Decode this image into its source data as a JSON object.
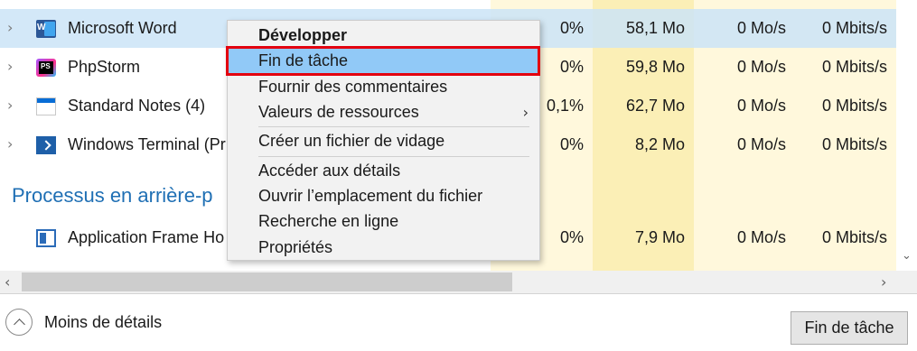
{
  "processes": [
    {
      "name": "Microsoft Word",
      "icon": "word-icon",
      "cpu": "0%",
      "memory": "58,1 Mo",
      "disk": "0 Mo/s",
      "network": "0 Mbits/s",
      "selected": true
    },
    {
      "name": "PhpStorm",
      "icon": "phpstorm-icon",
      "cpu": "0%",
      "memory": "59,8 Mo",
      "disk": "0 Mo/s",
      "network": "0 Mbits/s"
    },
    {
      "name": "Standard Notes (4)",
      "icon": "standard-notes-icon",
      "cpu": "0,1%",
      "memory": "62,7 Mo",
      "disk": "0 Mo/s",
      "network": "0 Mbits/s"
    },
    {
      "name": "Windows Terminal (Pr",
      "icon": "terminal-icon",
      "cpu": "0%",
      "memory": "8,2 Mo",
      "disk": "0 Mo/s",
      "network": "0 Mbits/s"
    }
  ],
  "background_group": {
    "heading": "Processus en arrière-p",
    "processes": [
      {
        "name": "Application Frame Ho",
        "icon": "app-frame-icon",
        "cpu": "0%",
        "memory": "7,9 Mo",
        "disk": "0 Mo/s",
        "network": "0 Mbits/s"
      }
    ]
  },
  "context_menu": {
    "items": [
      {
        "label": "Développer",
        "bold": true
      },
      {
        "label": "Fin de tâche",
        "highlighted": true
      },
      {
        "label": "Fournir des commentaires"
      },
      {
        "label": "Valeurs de ressources",
        "submenu": true,
        "arrow": "›"
      },
      {
        "label": "Créer un fichier de vidage"
      },
      {
        "label": "Accéder aux détails"
      },
      {
        "label": "Ouvrir l’emplacement du fichier"
      },
      {
        "label": "Recherche en ligne"
      },
      {
        "label": "Propriétés"
      }
    ]
  },
  "footer": {
    "less_details_label": "Moins de détails",
    "end_task_label": "Fin de tâche"
  },
  "glyphs": {
    "expand": "›",
    "scroll_left": "‹",
    "scroll_right": "›",
    "scroll_down": "⌄"
  },
  "colors": {
    "selection": "#cbe4f7",
    "menu_highlight": "#91c9f7",
    "annotation_box": "#e3000f",
    "group_heading": "#1f6fb4",
    "heat_light": "#fff8dc",
    "heat_mem": "#fbefb6"
  }
}
